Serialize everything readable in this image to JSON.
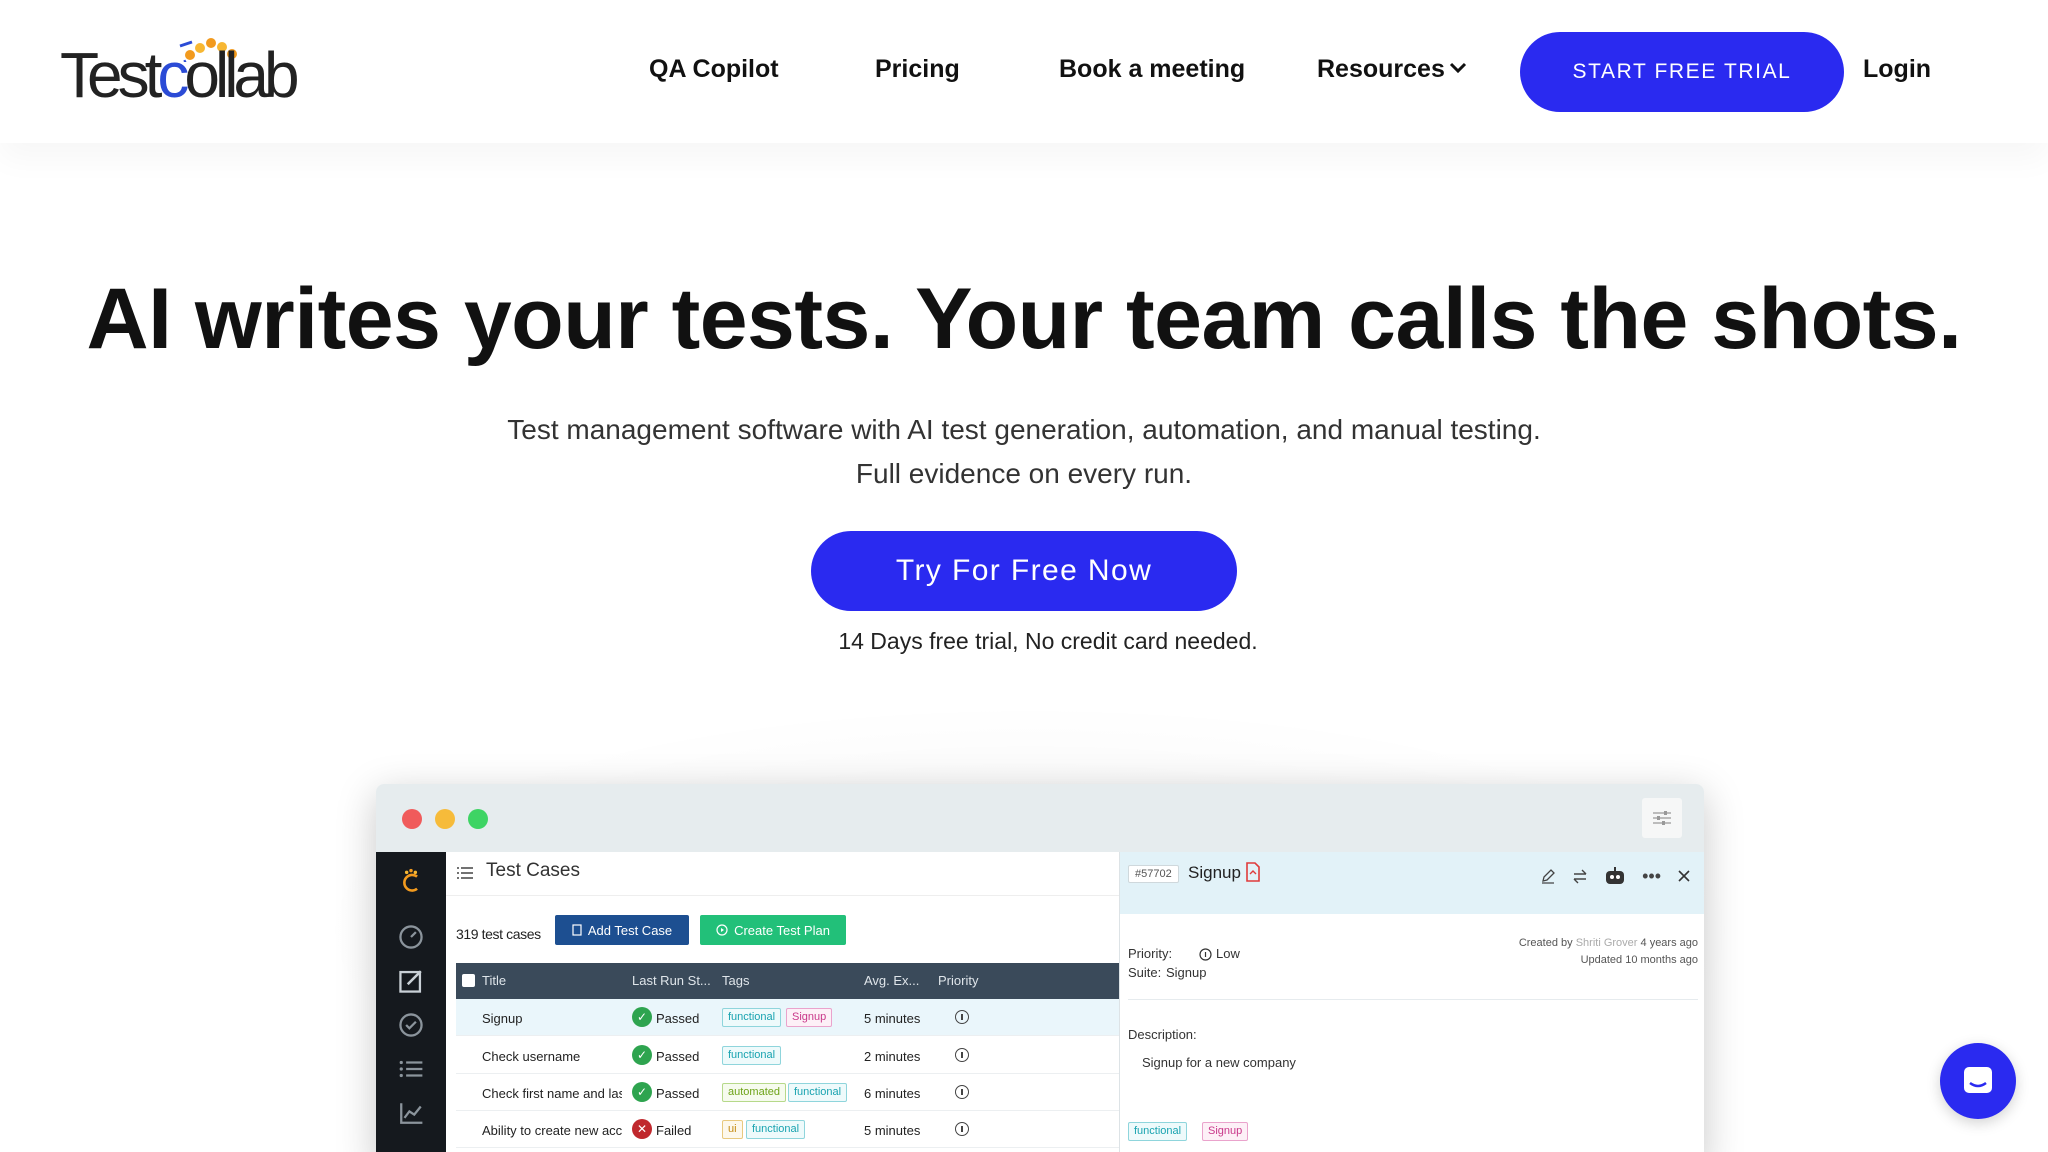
{
  "brand": {
    "logo_text_a": "Test",
    "logo_text_b": "c",
    "logo_text_c": "ollab",
    "accent": "#2a2af0"
  },
  "nav": {
    "qa_copilot": "QA Copilot",
    "pricing": "Pricing",
    "book_meeting": "Book a meeting",
    "resources": "Resources",
    "start_trial": "START FREE TRIAL",
    "login": "Login"
  },
  "hero": {
    "title": "AI writes your tests. Your team calls the shots.",
    "subtitle_line1": "Test management software with AI test generation, automation, and manual testing.",
    "subtitle_line2": "Full evidence on every run.",
    "cta": "Try For Free Now",
    "note": "14 Days free trial, No credit card needed."
  },
  "app": {
    "section_title": "Test Cases",
    "count": "319 test cases",
    "add_button": "Add Test Case",
    "plan_button": "Create Test Plan",
    "columns": [
      "Title",
      "Last Run St...",
      "Tags",
      "Avg. Ex...",
      "Priority"
    ],
    "rows": [
      {
        "title": "Signup",
        "status": "Passed",
        "tags": [
          "functional",
          "Signup"
        ],
        "avg": "5 minutes"
      },
      {
        "title": "Check username",
        "status": "Passed",
        "tags": [
          "functional"
        ],
        "avg": "2 minutes"
      },
      {
        "title": "Check first name and last nai",
        "status": "Passed",
        "tags": [
          "automated",
          "functional"
        ],
        "avg": "6 minutes"
      },
      {
        "title": "Ability to create new account",
        "status": "Failed",
        "tags": [
          "ui",
          "functional"
        ],
        "avg": "5 minutes"
      }
    ],
    "detail": {
      "id": "#57702",
      "title": "Signup",
      "priority_label": "Priority:",
      "priority_value": "Low",
      "suite_label": "Suite:",
      "suite_value": "Signup",
      "created_prefix": "Created by",
      "created_by": "Shriti Grover",
      "created_when": "4 years ago",
      "updated": "Updated 10 months ago",
      "description_label": "Description:",
      "description": "Signup for a new company",
      "tags": [
        "functional",
        "Signup"
      ]
    }
  }
}
